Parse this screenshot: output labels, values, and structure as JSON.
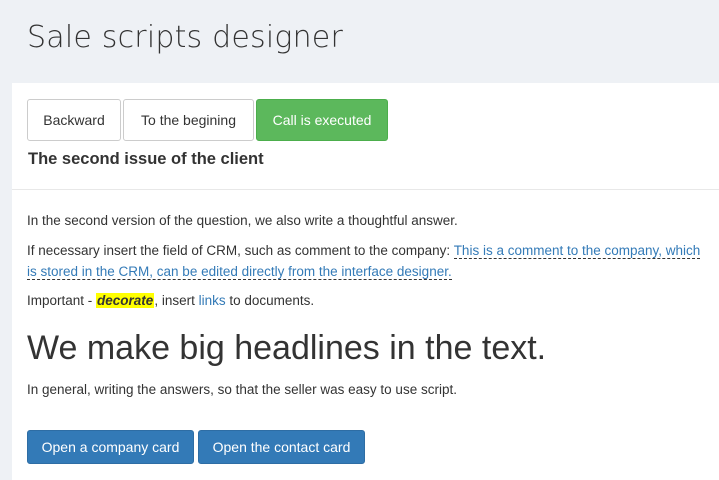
{
  "header": {
    "title": "Sale scripts designer"
  },
  "toolbar": {
    "backward_label": "Backward",
    "beginning_label": "To the begining",
    "executed_label": "Call is executed"
  },
  "question": {
    "title": "The second issue of the client"
  },
  "content": {
    "paragraph1": "In the second version of the question, we also write a thoughtful answer.",
    "paragraph2_prefix": "If necessary insert the field of CRM, such as comment to the company: ",
    "crm_field_text": "This is a comment to the company, which is stored in the CRM, can be edited directly from the interface designer.",
    "paragraph3_prefix": "Important - ",
    "decorate_text": "decorate",
    "paragraph3_middle": ", insert ",
    "links_text": "links",
    "paragraph3_suffix": " to documents.",
    "headline": "We make big headlines in the text.",
    "paragraph4": "In general, writing the answers, so that the seller was easy to use script."
  },
  "actions": {
    "company_card_label": "Open a company card",
    "contact_card_label": "Open the contact card"
  },
  "colors": {
    "success": "#5cb85c",
    "primary": "#337ab7",
    "highlight": "#ffff00"
  }
}
